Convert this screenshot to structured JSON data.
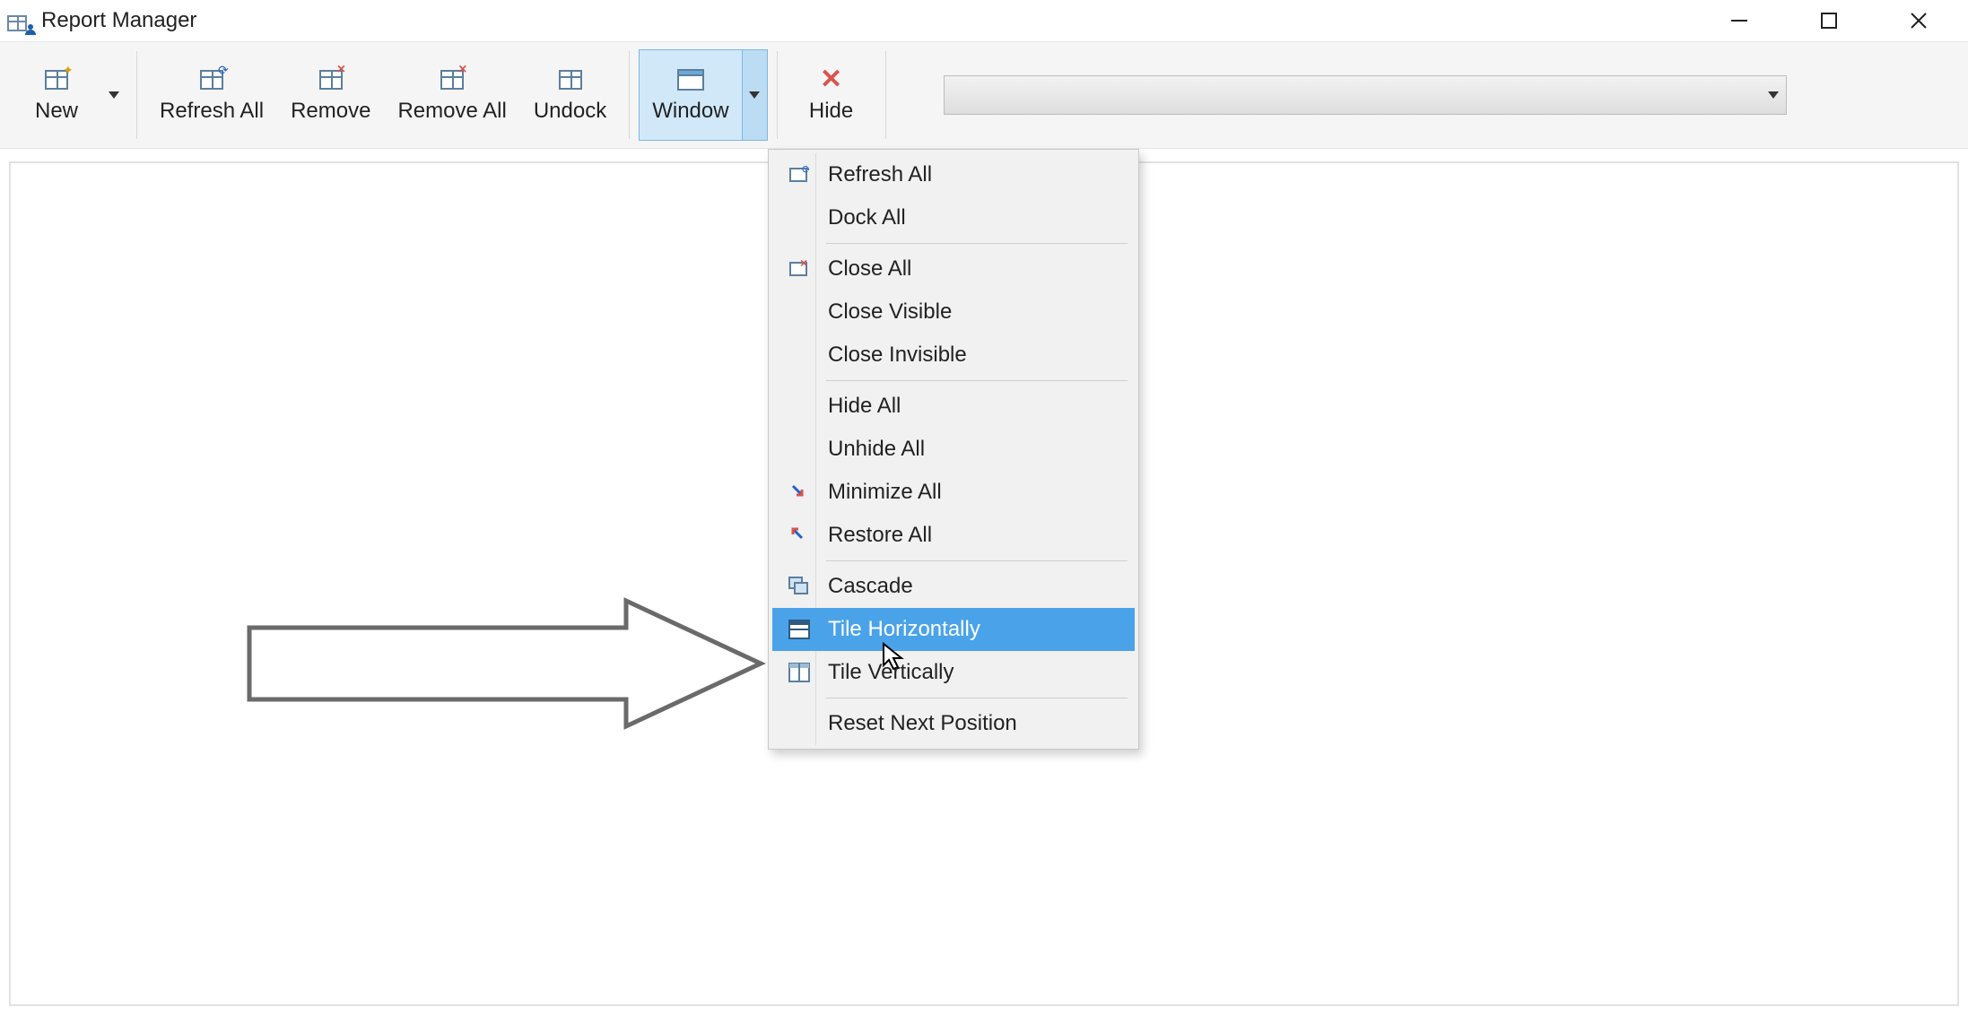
{
  "window": {
    "title": "Report Manager"
  },
  "toolbar": {
    "new": "New",
    "refresh_all": "Refresh All",
    "remove": "Remove",
    "remove_all": "Remove All",
    "undock": "Undock",
    "window": "Window",
    "hide": "Hide",
    "combo_value": ""
  },
  "menu": {
    "refresh_all": "Refresh All",
    "dock_all": "Dock All",
    "close_all": "Close All",
    "close_visible": "Close Visible",
    "close_invisible": "Close Invisible",
    "hide_all": "Hide All",
    "unhide_all": "Unhide All",
    "minimize_all": "Minimize All",
    "restore_all": "Restore All",
    "cascade": "Cascade",
    "tile_horizontally": "Tile Horizontally",
    "tile_vertically": "Tile Vertically",
    "reset_next_position": "Reset Next Position",
    "highlighted": "tile_horizontally"
  }
}
